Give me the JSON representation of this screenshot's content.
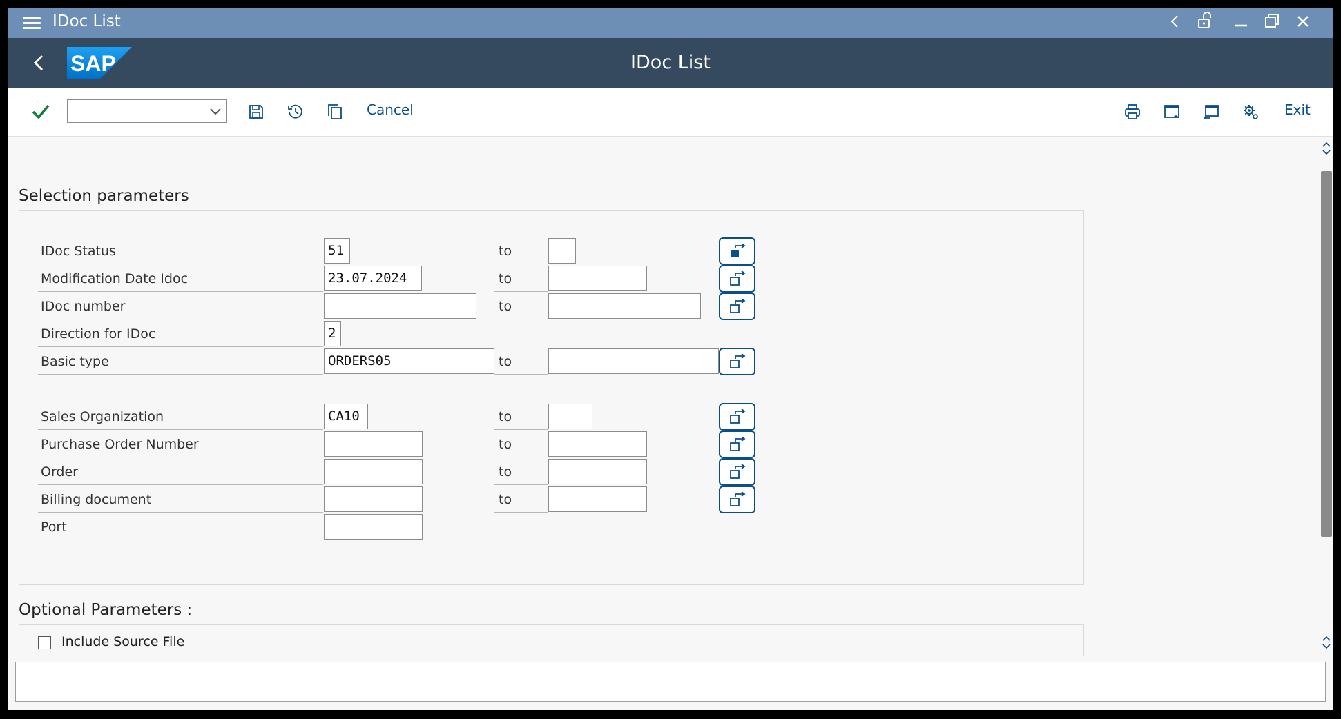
{
  "window": {
    "title": "IDoc List"
  },
  "shell": {
    "app_title": "IDoc List",
    "logo_text": "SAP"
  },
  "toolbar": {
    "cancel_label": "Cancel",
    "exit_label": "Exit",
    "command_value": ""
  },
  "selection": {
    "title": "Selection parameters",
    "to_label": "to",
    "rows": [
      {
        "label": "IDoc Status",
        "from": "51",
        "to": ""
      },
      {
        "label": "Modification Date Idoc",
        "from": "23.07.2024",
        "to": ""
      },
      {
        "label": "IDoc number",
        "from": "",
        "to": ""
      },
      {
        "label": "Direction for IDoc",
        "from": "2"
      },
      {
        "label": "Basic type",
        "from": "ORDERS05",
        "to": ""
      },
      {
        "label": "Sales Organization",
        "from": "CA10",
        "to": ""
      },
      {
        "label": "Purchase Order Number",
        "from": "",
        "to": ""
      },
      {
        "label": "Order",
        "from": "",
        "to": ""
      },
      {
        "label": "Billing document",
        "from": "",
        "to": ""
      },
      {
        "label": "Port",
        "from": ""
      }
    ]
  },
  "optional": {
    "title": "Optional Parameters :",
    "checkboxes": [
      {
        "label": "Include Source File",
        "checked": false
      }
    ]
  },
  "status_bar": {
    "text": ""
  },
  "colors": {
    "title_bar": "#6e8fb5",
    "shell_header": "#354a5f",
    "accent": "#0a4f8a",
    "confirm": "#107e3e"
  }
}
